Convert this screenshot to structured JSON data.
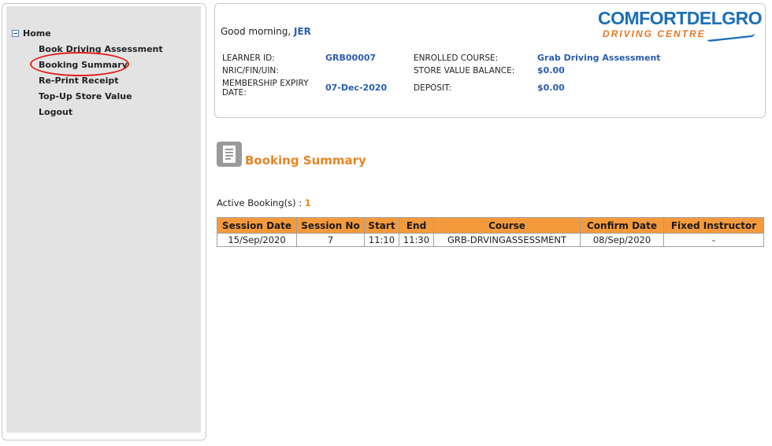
{
  "sidebar": {
    "home_label": "Home",
    "items": [
      {
        "label": "Book Driving Assessment"
      },
      {
        "label": "Booking Summary"
      },
      {
        "label": "Re-Print Receipt"
      },
      {
        "label": "Top-Up Store Value"
      },
      {
        "label": "Logout"
      }
    ],
    "active_index": 1
  },
  "header": {
    "greeting": "Good morning,",
    "user_name": "JER",
    "logo": {
      "top_text": "COMFORTDELGRO",
      "bottom_text": "DRIVING CENTRE",
      "colors": {
        "top": "#1c6fb8",
        "bottom": "#e87722"
      }
    },
    "info": {
      "learner_id_label": "LEARNER ID:",
      "learner_id": "GRB00007",
      "nric_label": "NRIC/FIN/UIN:",
      "nric": "",
      "membership_label_1": "MEMBERSHIP EXPIRY",
      "membership_label_2": "DATE:",
      "membership_expiry": "07-Dec-2020",
      "enrolled_course_label": "ENROLLED COURSE:",
      "enrolled_course": "Grab Driving Assessment",
      "store_value_label": "STORE VALUE BALANCE:",
      "store_value": "$0.00",
      "deposit_label": "DEPOSIT:",
      "deposit": "$0.00"
    }
  },
  "main": {
    "title": "Booking Summary",
    "icon": "document-icon",
    "active_bookings_label": "Active Booking(s) :",
    "active_bookings_count": "1",
    "table": {
      "columns": [
        "Session Date",
        "Session No",
        "Start",
        "End",
        "Course",
        "Confirm Date",
        "Fixed Instructor"
      ],
      "rows": [
        [
          "15/Sep/2020",
          "7",
          "11:10",
          "11:30",
          "GRB-DRVINGASSESSMENT",
          "08/Sep/2020",
          "-"
        ]
      ]
    }
  },
  "colors": {
    "accent_orange": "#e88522",
    "table_header": "#f59a3c",
    "link_blue": "#2a5db0",
    "highlight_red": "#e01e1e"
  }
}
